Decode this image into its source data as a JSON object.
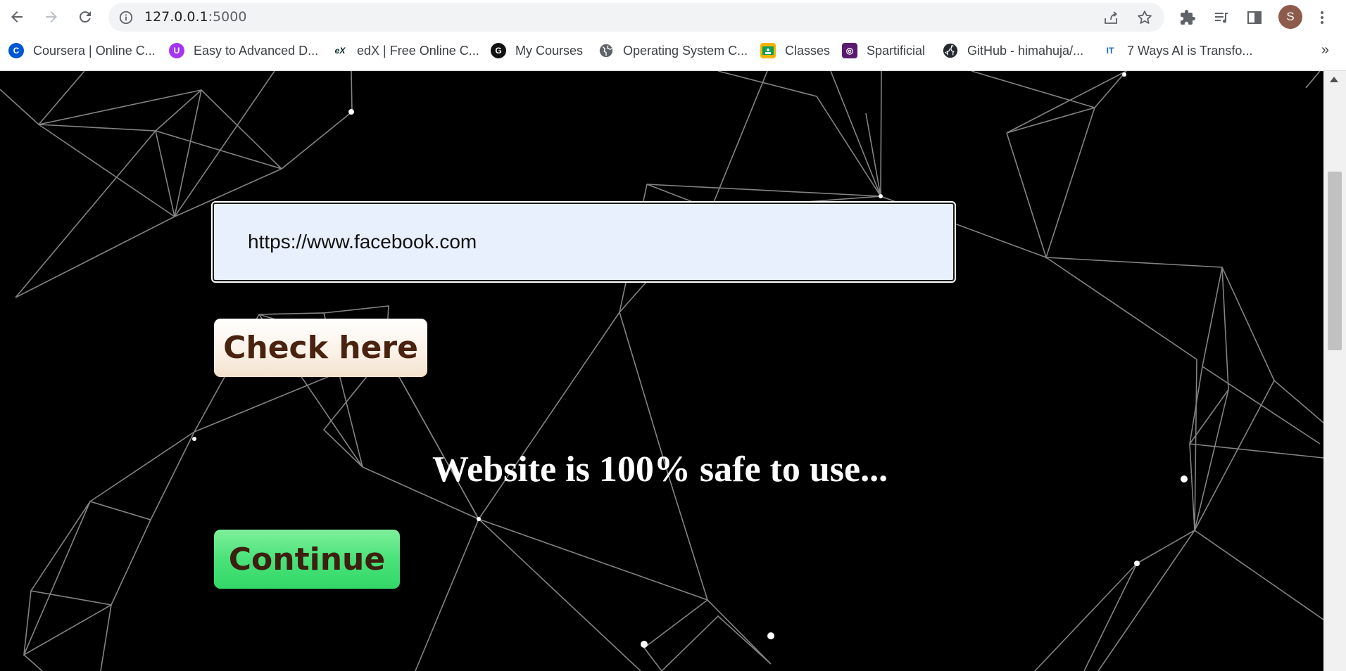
{
  "browser": {
    "url_host": "127.0.0.1",
    "url_port": ":5000",
    "profile_initial": "S",
    "bookmarks": [
      {
        "label": "Coursera | Online C...",
        "icon": "coursera-icon",
        "color": "#0056d2",
        "glyph": "C"
      },
      {
        "label": "Easy to Advanced D...",
        "icon": "udemy-icon",
        "color": "#a435f0",
        "glyph": "U"
      },
      {
        "label": "edX | Free Online C...",
        "icon": "edx-icon",
        "color": "#02262b",
        "glyph": "eX"
      },
      {
        "label": "My Courses",
        "icon": "g-icon",
        "color": "#111111",
        "glyph": "G"
      },
      {
        "label": "Operating System C...",
        "icon": "globe-icon",
        "color": "#5f6368",
        "glyph": ""
      },
      {
        "label": "Classes",
        "icon": "classroom-icon",
        "color": "#f4b400",
        "glyph": ""
      },
      {
        "label": "Spartificial",
        "icon": "spartificial-icon",
        "color": "#5a1a6e",
        "glyph": "◎"
      },
      {
        "label": "GitHub - himahuja/...",
        "icon": "github-icon",
        "color": "#24292f",
        "glyph": ""
      },
      {
        "label": "7 Ways AI is Transfo...",
        "icon": "article-icon",
        "color": "#1565c0",
        "glyph": "IT"
      }
    ]
  },
  "page": {
    "url_value": "https://www.facebook.com",
    "check_button": "Check here",
    "result_text": "Website is 100% safe to use...",
    "continue_button": "Continue"
  },
  "colors": {
    "background": "#000000",
    "input_bg": "#e8f0fe",
    "check_button_bg": "#fbf1e6",
    "continue_button_bg": "#4ae27a",
    "button_text": "#4a2210"
  }
}
